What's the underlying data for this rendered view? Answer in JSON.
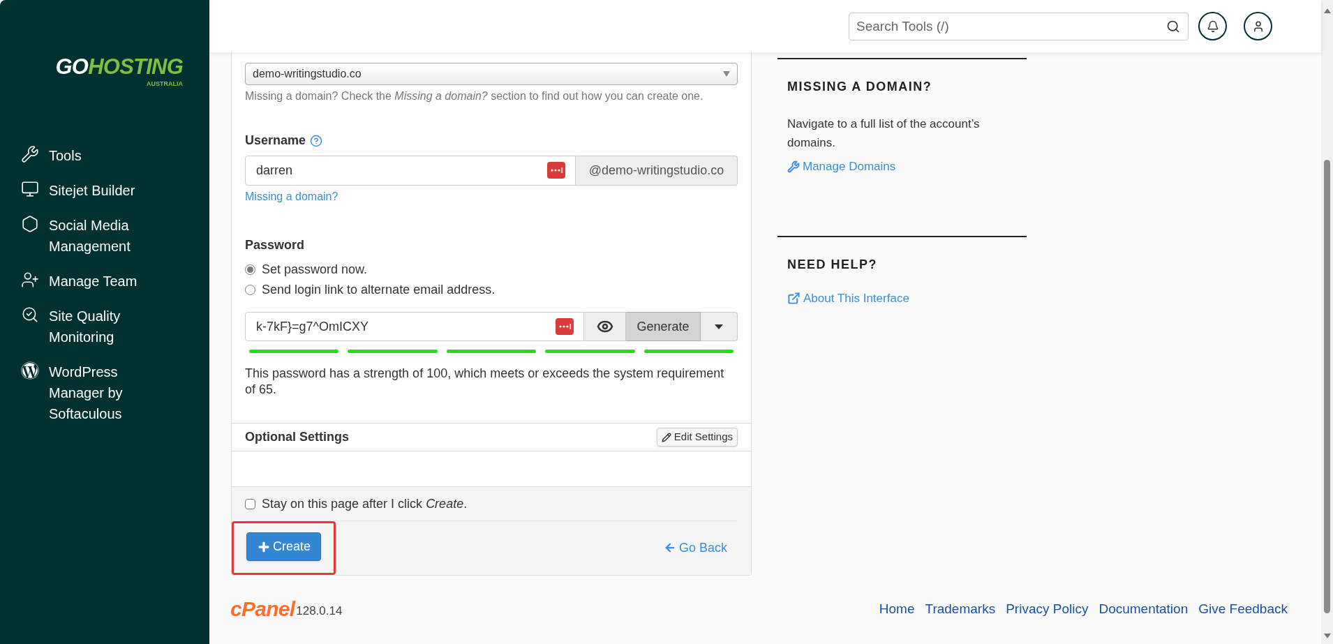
{
  "brand": {
    "name_first": "GO",
    "name_second": "HOSTING",
    "tagline": "AUSTRALIA"
  },
  "sidebar": {
    "items": [
      {
        "label": "Tools",
        "kind": "tools"
      },
      {
        "label": "Sitejet Builder",
        "kind": "monitor"
      },
      {
        "label": "Social Media Management",
        "kind": "hexagon"
      },
      {
        "label": "Manage Team",
        "kind": "team"
      },
      {
        "label": "Site Quality Monitoring",
        "kind": "quality"
      },
      {
        "label": "WordPress Manager by Softaculous",
        "kind": "wordpress"
      }
    ]
  },
  "header": {
    "search": {
      "placeholder": "Search Tools (/)"
    }
  },
  "form": {
    "domain": {
      "value": "demo-writingstudio.co",
      "help": "Missing a domain? Check the *Missing a domain?* section to find out how you can create one."
    },
    "username": {
      "label": "Username",
      "value": "darren",
      "suffix": "@demo-writingstudio.co",
      "link": "Missing a domain?"
    },
    "password": {
      "label": "Password",
      "options": [
        {
          "label": "Set password now.",
          "selected": true
        },
        {
          "label": "Send login link to alternate email address.",
          "selected": false
        }
      ],
      "value": "k-7kF}=g7^OmICXY",
      "generate": "Generate",
      "strength": {
        "segments": [
          {
            "lit": true
          },
          {
            "lit": true
          },
          {
            "lit": true
          },
          {
            "lit": true
          },
          {
            "lit": true
          }
        ]
      },
      "message": "This password has a strength of 100, which meets or exceeds the system requirement of 65."
    },
    "optional": {
      "title": "Optional Settings",
      "button": "Edit Settings"
    },
    "stay": {
      "label": "Stay on this page after I click *Create*.",
      "checked": false
    },
    "create": {
      "label": "Create",
      "highlighted": true
    },
    "go_back": "Go Back"
  },
  "panels": [
    {
      "title": "MISSING A DOMAIN?",
      "text": "Navigate to a full list of the account’s domains.",
      "link": "Manage Domains",
      "kind": "wrench"
    },
    {
      "title": "NEED HELP?",
      "link": "About This Interface",
      "kind": "external"
    }
  ],
  "footer": {
    "logo": "cPanel",
    "version": "128.0.14",
    "links": [
      "Home",
      "Trademarks",
      "Privacy Policy",
      "Documentation",
      "Give Feedback"
    ]
  }
}
